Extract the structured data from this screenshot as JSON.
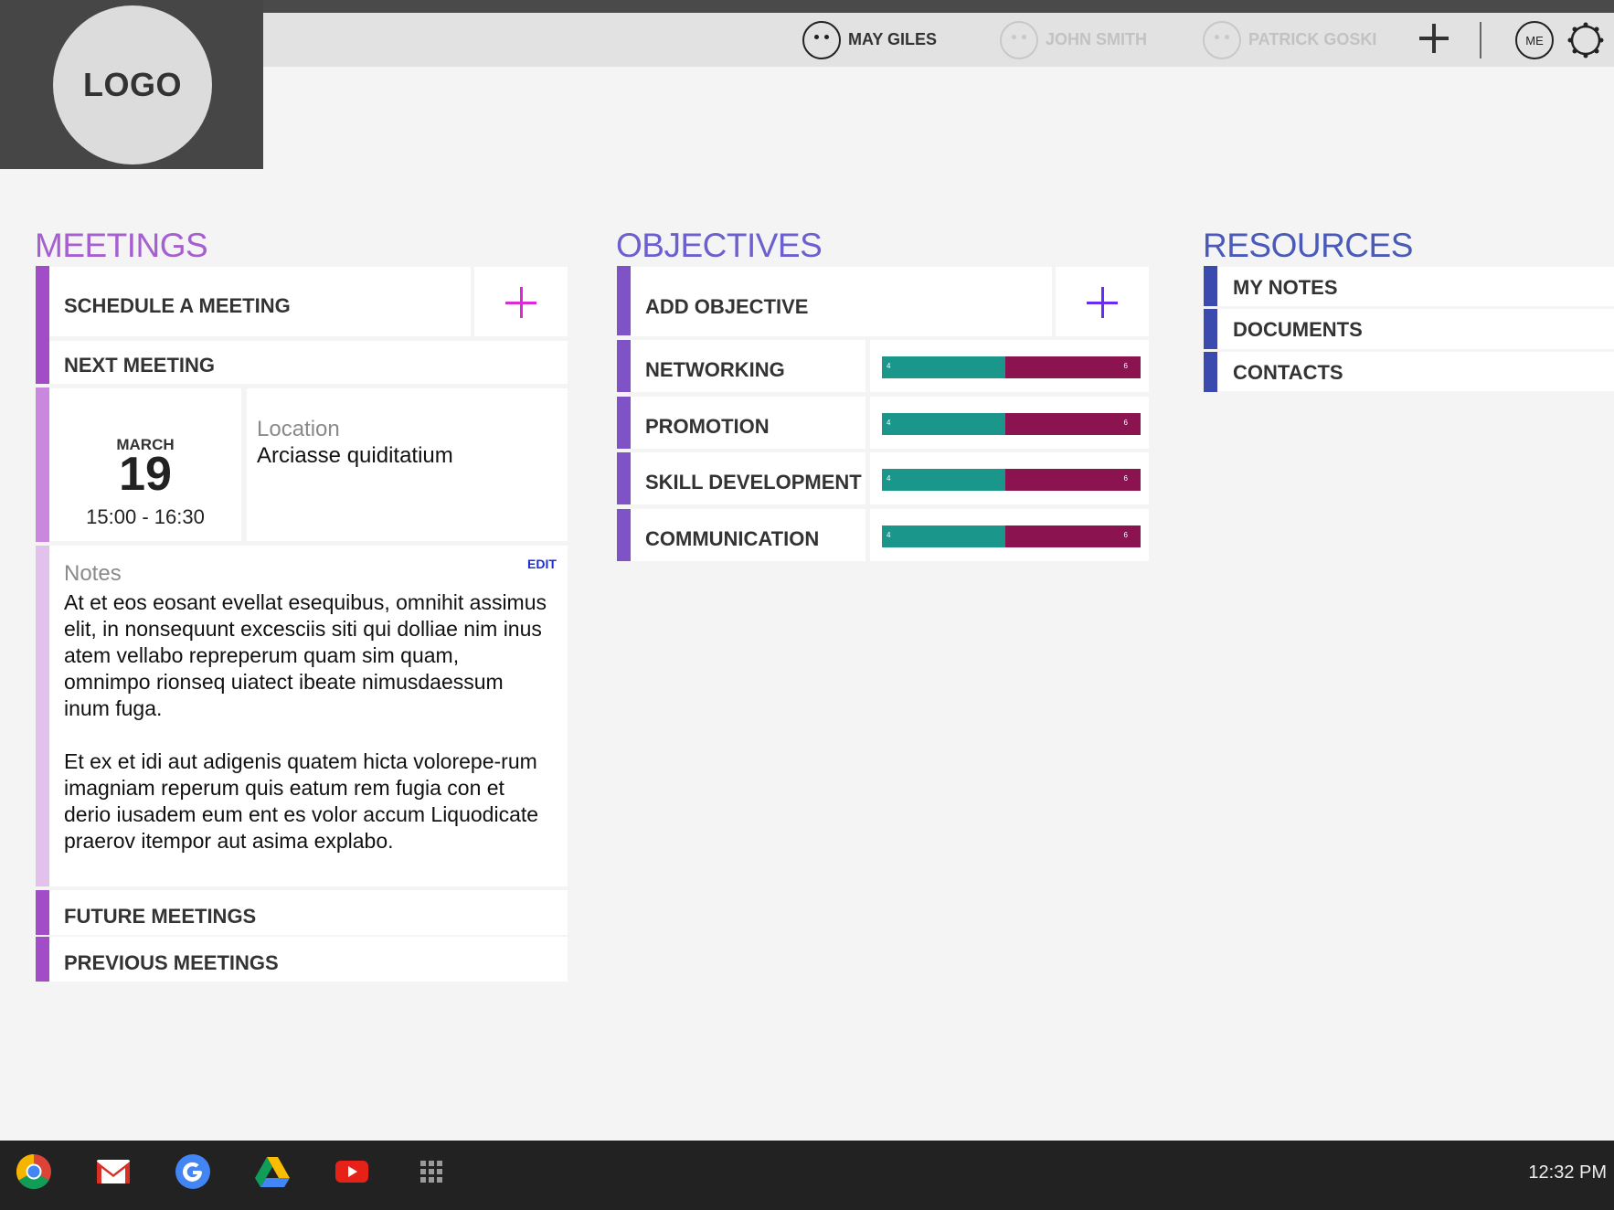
{
  "logo": {
    "text": "LOGO"
  },
  "users": [
    {
      "name": "MAY GILES",
      "active": true
    },
    {
      "name": "JOHN SMITH",
      "active": false
    },
    {
      "name": "PATRICK GOSKI",
      "active": false
    }
  ],
  "header": {
    "me_label": "ME",
    "add_icon": "plus-icon",
    "settings_icon": "gear-icon"
  },
  "meetings": {
    "title": "MEETINGS",
    "schedule_label": "SCHEDULE A MEETING",
    "next_label": "NEXT MEETING",
    "next": {
      "month": "MARCH",
      "day": "19",
      "time": "15:00 - 16:30",
      "location_label": "Location",
      "location_value": "Arciasse quiditatium",
      "notes_label": "Notes",
      "edit_label": "EDIT",
      "notes_p1": "At et eos eosant evellat esequibus, omnihit assimus elit, in nonsequunt excesciis siti qui dolliae nim inus atem vellabo repreperum quam sim quam, omnimpo rionseq uiatect ibeate nimusdaessum inum fuga.",
      "notes_p2": "Et ex et idi aut adigenis quatem hicta volorepe-rum imagniam reperum quis eatum rem fugia con et derio iusadem eum ent es volor accum Liquodicate praerov itempor aut asima explabo."
    },
    "future_label": "FUTURE MEETINGS",
    "previous_label": "PREVIOUS MEETINGS"
  },
  "objectives": {
    "title": "OBJECTIVES",
    "add_label": "ADD OBJECTIVE",
    "items": [
      {
        "label": "NETWORKING",
        "done": 4,
        "remaining": 6,
        "done_text": "4",
        "remaining_text": "6"
      },
      {
        "label": "PROMOTION",
        "done": 4,
        "remaining": 6,
        "done_text": "4",
        "remaining_text": "6"
      },
      {
        "label": "SKILL DEVELOPMENT",
        "done": 4,
        "remaining": 6,
        "done_text": "4",
        "remaining_text": "6"
      },
      {
        "label": "COMMUNICATION",
        "done": 4,
        "remaining": 6,
        "done_text": "4",
        "remaining_text": "6"
      }
    ]
  },
  "resources": {
    "title": "RESOURCES",
    "items": [
      {
        "label": "MY NOTES"
      },
      {
        "label": "DOCUMENTS"
      },
      {
        "label": "CONTACTS"
      }
    ]
  },
  "colors": {
    "meetings_accent": "#a34cc8",
    "meetings_title": "#a65fd0",
    "objectives_accent": "#7f52c6",
    "objectives_title": "#6c5fcf",
    "resources_accent": "#3a4aaf",
    "resources_title": "#4a5ab8",
    "plus_meetings": "#d92bd9",
    "plus_objectives": "#6a2cf0",
    "progress_done": "#1a968a",
    "progress_remaining": "#8a1350"
  },
  "taskbar": {
    "apps": [
      "chrome-icon",
      "gmail-icon",
      "google-icon",
      "drive-icon",
      "youtube-icon",
      "apps-grid-icon"
    ],
    "clock": "12:32 PM"
  }
}
